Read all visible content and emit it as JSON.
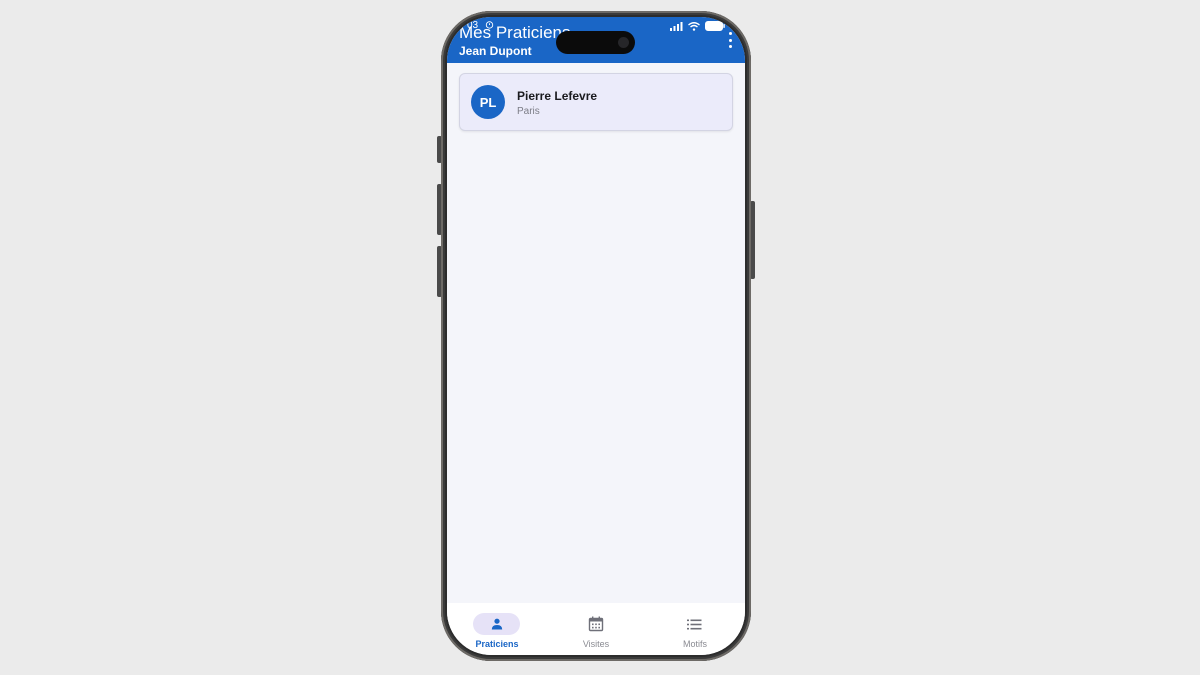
{
  "status_bar": {
    "time": "03",
    "icons": [
      "alarm-icon",
      "signal-icon",
      "wifi-icon",
      "battery-icon"
    ]
  },
  "app_bar": {
    "title": "Mes Praticiens",
    "subtitle": "Jean Dupont",
    "menu_icon": "more-vert-icon",
    "background": "#1a66c6"
  },
  "practitioners": [
    {
      "initials": "PL",
      "name": "Pierre Lefevre",
      "city": "Paris"
    }
  ],
  "bottom_nav": {
    "active_index": 0,
    "items": [
      {
        "label": "Praticiens",
        "icon": "person-icon"
      },
      {
        "label": "Visites",
        "icon": "calendar-icon"
      },
      {
        "label": "Motifs",
        "icon": "list-icon"
      }
    ]
  },
  "colors": {
    "primary": "#1a66c6",
    "card_background": "#ebebfa",
    "screen_background": "#f4f5fa",
    "nav_active_pill": "#e6e2f7",
    "nav_inactive": "#8a8b92"
  }
}
